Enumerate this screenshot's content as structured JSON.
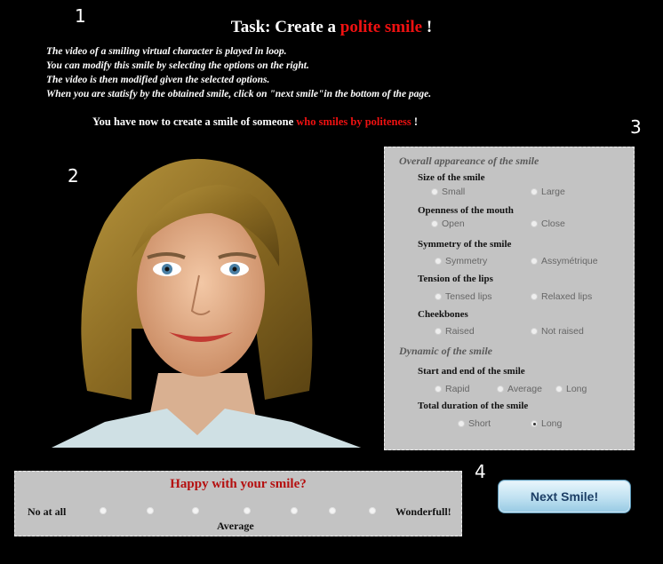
{
  "step_numbers": {
    "one": "1",
    "two": "2",
    "three": "3",
    "four": "4"
  },
  "title": {
    "prefix": "Task: Create a ",
    "highlight": "polite smile",
    "suffix": " !"
  },
  "instructions": [
    "The video of a smiling virtual character  is played in loop.",
    "You can modify this smile by selecting the options on the right.",
    "The video is then modified given the selected options.",
    "When you are statisfy by the obtained smile, click on \"next smile\"in the bottom of the page."
  ],
  "subtask": {
    "prefix": "You have now to create a smile of someone ",
    "highlight": "who smiles by politeness",
    "suffix": " !"
  },
  "panel": {
    "overall_title": "Overall appareance of the smile",
    "size": {
      "label": "Size of the smile",
      "a": "Small",
      "b": "Large"
    },
    "openness": {
      "label": "Openness of the mouth",
      "a": "Open",
      "b": "Close"
    },
    "symmetry": {
      "label": "Symmetry of the smile",
      "a": "Symmetry",
      "b": "Assymétrique"
    },
    "tension": {
      "label": "Tension of the lips",
      "a": "Tensed lips",
      "b": "Relaxed lips"
    },
    "cheek": {
      "label": "Cheekbones",
      "a": "Raised",
      "b": "Not raised"
    },
    "dynamic_title": "Dynamic of the smile",
    "start": {
      "label": "Start and end of the smile",
      "a": "Rapid",
      "b": "Average",
      "c": "Long"
    },
    "duration": {
      "label": "Total duration of the smile",
      "a": "Short",
      "b": "Long",
      "selected": "Long"
    }
  },
  "rating": {
    "question": "Happy with your smile?",
    "low": "No at all",
    "mid": "Average",
    "high": "Wonderfull!",
    "points": 7
  },
  "next_button": "Next Smile!",
  "colors": {
    "highlight": "#e11111",
    "panel_bg": "#c3c3c3",
    "button": "#bfe1f1"
  }
}
